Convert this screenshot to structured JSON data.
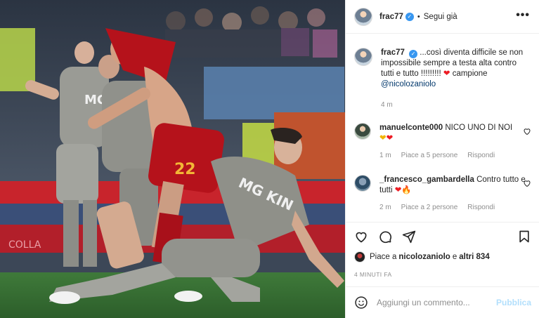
{
  "post": {
    "username": "frac77",
    "follow_label": "Segui già",
    "more_label": "•••"
  },
  "caption": {
    "username": "frac77",
    "text": "...così diventa difficile se non impossibile sempre a testa alta contro tutti e tutto !!!!!!!!! ",
    "text_after": " campione",
    "mention": "@nicolozaniolo",
    "time": "4 m"
  },
  "comments": [
    {
      "username": "manuelconte000",
      "text": "NICO UNO DI NOI",
      "time": "1 m",
      "likes": "Piace a 5 persone",
      "reply": "Rispondi"
    },
    {
      "username": "_francesco_gambardella",
      "text": "Contro tutto e tutti",
      "time": "2 m",
      "likes": "Piace a 2 persone",
      "reply": "Rispondi"
    }
  ],
  "likes_line": {
    "prefix": "Piace a ",
    "user": "nicolozaniolo",
    "mid": " e ",
    "others": "altri 834"
  },
  "timestamp": "4 MINUTI FA",
  "composer": {
    "placeholder": "Aggiungi un commento...",
    "publish": "Pubblica"
  },
  "photo_text": {
    "jersey_number": "22",
    "sponsor_a": "MG",
    "sponsor_b": "MG KIN",
    "banner": "COLLA"
  },
  "colors": {
    "verified": "#3897f0",
    "heart": "#ed1c24",
    "mention": "#00376b",
    "publish": "#b2dffc",
    "roma_red": "#b5121b",
    "spezia_grey": "#8f9089"
  },
  "icons": [
    "more-icon",
    "verified-icon",
    "heart-icon",
    "comment-icon",
    "share-icon",
    "save-icon",
    "emoji-icon"
  ]
}
